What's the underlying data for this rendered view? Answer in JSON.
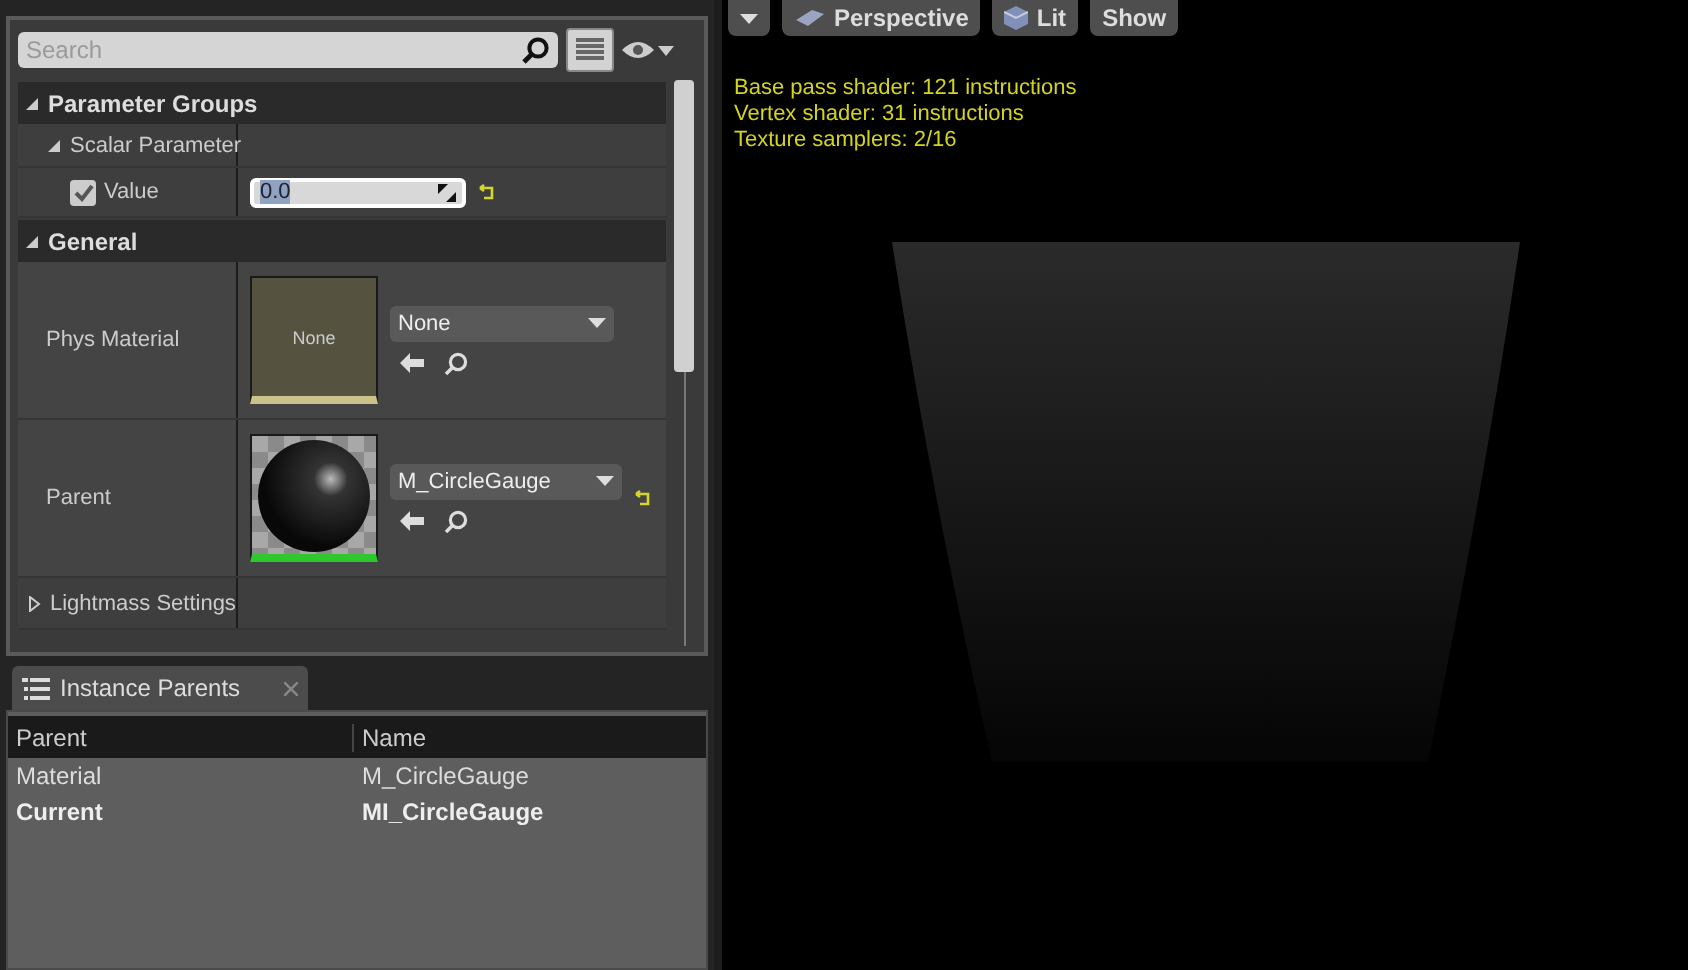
{
  "details": {
    "search": {
      "placeholder": "Search"
    },
    "categories": [
      {
        "title": "Parameter Groups",
        "expanded": true,
        "rows": [
          {
            "kind": "group",
            "label": "Scalar Parameter",
            "expanded": true
          },
          {
            "kind": "scalar",
            "label": "Value",
            "checked": true,
            "value": "0.0",
            "reset": true
          }
        ]
      },
      {
        "title": "General",
        "expanded": true,
        "rows": [
          {
            "kind": "asset",
            "label": "Phys Material",
            "thumbnail": {
              "kind": "empty",
              "label": "None"
            },
            "combo": "None",
            "reset": false
          },
          {
            "kind": "asset",
            "label": "Parent",
            "thumbnail": {
              "kind": "sphere"
            },
            "combo": "M_CircleGauge",
            "reset": true
          },
          {
            "kind": "group",
            "label": "Lightmass Settings",
            "expanded": false
          }
        ]
      }
    ]
  },
  "instance_parents": {
    "tab": "Instance Parents",
    "columns": [
      "Parent",
      "Name"
    ],
    "rows": [
      {
        "cells": [
          "Material",
          "M_CircleGauge"
        ],
        "current": false
      },
      {
        "cells": [
          "Current",
          "MI_CircleGauge"
        ],
        "current": true
      }
    ]
  },
  "viewport": {
    "buttons": [
      {
        "kind": "menu"
      },
      {
        "kind": "perspective",
        "label": "Perspective"
      },
      {
        "kind": "lit",
        "label": "Lit"
      },
      {
        "kind": "plain",
        "label": "Show"
      }
    ],
    "stats": [
      "Base pass shader: 121 instructions",
      "Vertex shader: 31 instructions",
      "Texture samplers: 2/16"
    ]
  }
}
